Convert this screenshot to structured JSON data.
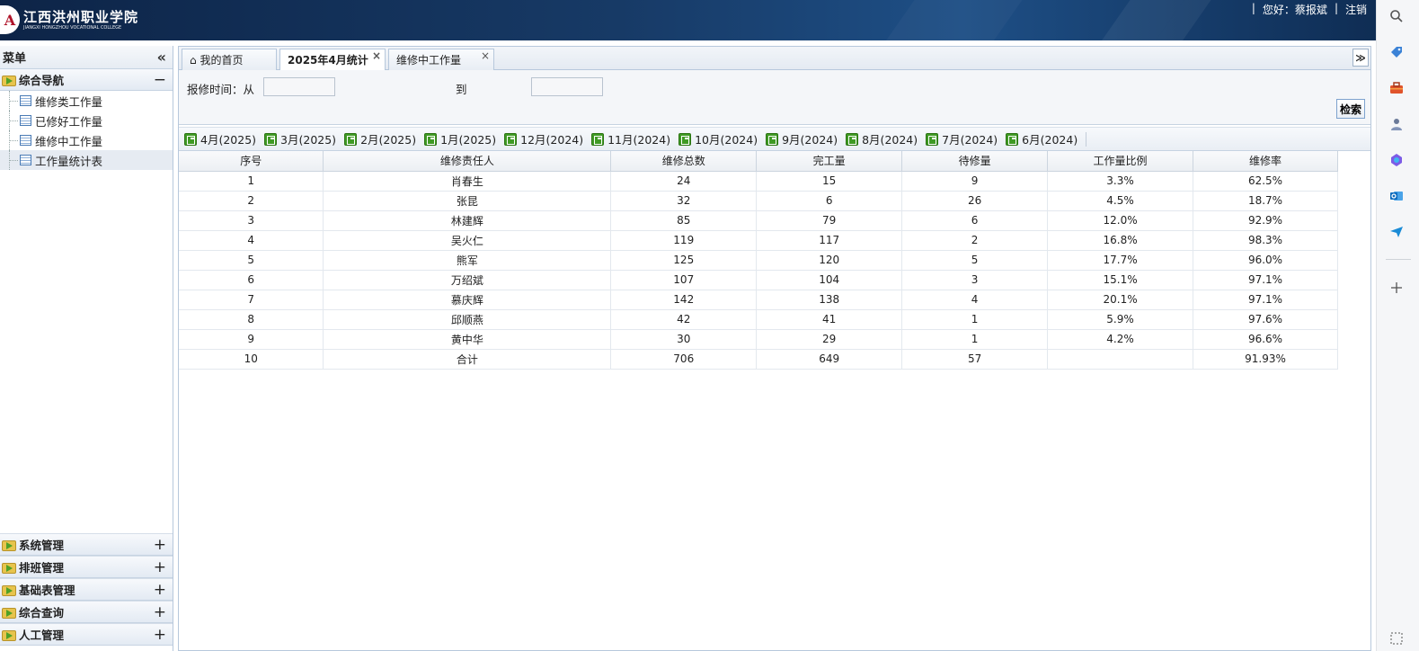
{
  "header": {
    "logo_seal": "A",
    "logo_cn": "江西洪州职业学院",
    "logo_en": "JIANGXI HONGZHOU VOCATIONAL COLLEGE",
    "sep1": "|",
    "greeting": "您好：蔡报斌",
    "sep2": "|",
    "logout": "注销"
  },
  "rail": {
    "icons": [
      "search-icon",
      "tag-icon",
      "toolbox-icon",
      "person-icon",
      "copilot-icon",
      "outlook-icon",
      "send-icon",
      "plus-icon",
      "expand-icon"
    ]
  },
  "sidebar": {
    "title": "菜单",
    "collapse": "«",
    "panels_top": [
      {
        "label": "综合导航",
        "toggle": "−"
      }
    ],
    "items": [
      {
        "label": "维修类工作量"
      },
      {
        "label": "已修好工作量"
      },
      {
        "label": "维修中工作量"
      },
      {
        "label": "工作量统计表"
      }
    ],
    "panels_bottom": [
      {
        "label": "系统管理",
        "toggle": "+"
      },
      {
        "label": "排班管理",
        "toggle": "+"
      },
      {
        "label": "基础表管理",
        "toggle": "+"
      },
      {
        "label": "综合查询",
        "toggle": "+"
      },
      {
        "label": "人工管理",
        "toggle": "+"
      }
    ]
  },
  "tabs": [
    {
      "label": "我的首页",
      "home_icon": "⌂"
    },
    {
      "label": "2025年4月统计",
      "close": "×"
    },
    {
      "label": "维修中工作量",
      "close": "×"
    }
  ],
  "tab_menu": "≫",
  "search": {
    "label_from": "报修时间：从",
    "label_to": "到",
    "from_value": "",
    "to_value": "",
    "button": "检索"
  },
  "months": [
    "4月(2025)",
    "3月(2025)",
    "2月(2025)",
    "1月(2025)",
    "12月(2024)",
    "11月(2024)",
    "10月(2024)",
    "9月(2024)",
    "8月(2024)",
    "7月(2024)",
    "6月(2024)"
  ],
  "table": {
    "headers": [
      "序号",
      "维修责任人",
      "维修总数",
      "完工量",
      "待修量",
      "工作量比例",
      "维修率"
    ],
    "rows": [
      [
        "1",
        "肖春生",
        "24",
        "15",
        "9",
        "3.3%",
        "62.5%"
      ],
      [
        "2",
        "张昆",
        "32",
        "6",
        "26",
        "4.5%",
        "18.7%"
      ],
      [
        "3",
        "林建辉",
        "85",
        "79",
        "6",
        "12.0%",
        "92.9%"
      ],
      [
        "4",
        "吴火仁",
        "119",
        "117",
        "2",
        "16.8%",
        "98.3%"
      ],
      [
        "5",
        "熊军",
        "125",
        "120",
        "5",
        "17.7%",
        "96.0%"
      ],
      [
        "6",
        "万绍斌",
        "107",
        "104",
        "3",
        "15.1%",
        "97.1%"
      ],
      [
        "7",
        "慕庆辉",
        "142",
        "138",
        "4",
        "20.1%",
        "97.1%"
      ],
      [
        "8",
        "邱顺燕",
        "42",
        "41",
        "1",
        "5.9%",
        "97.6%"
      ],
      [
        "9",
        "黄中华",
        "30",
        "29",
        "1",
        "4.2%",
        "96.6%"
      ],
      [
        "10",
        "合计",
        "706",
        "649",
        "57",
        "",
        "91.93%"
      ]
    ]
  }
}
